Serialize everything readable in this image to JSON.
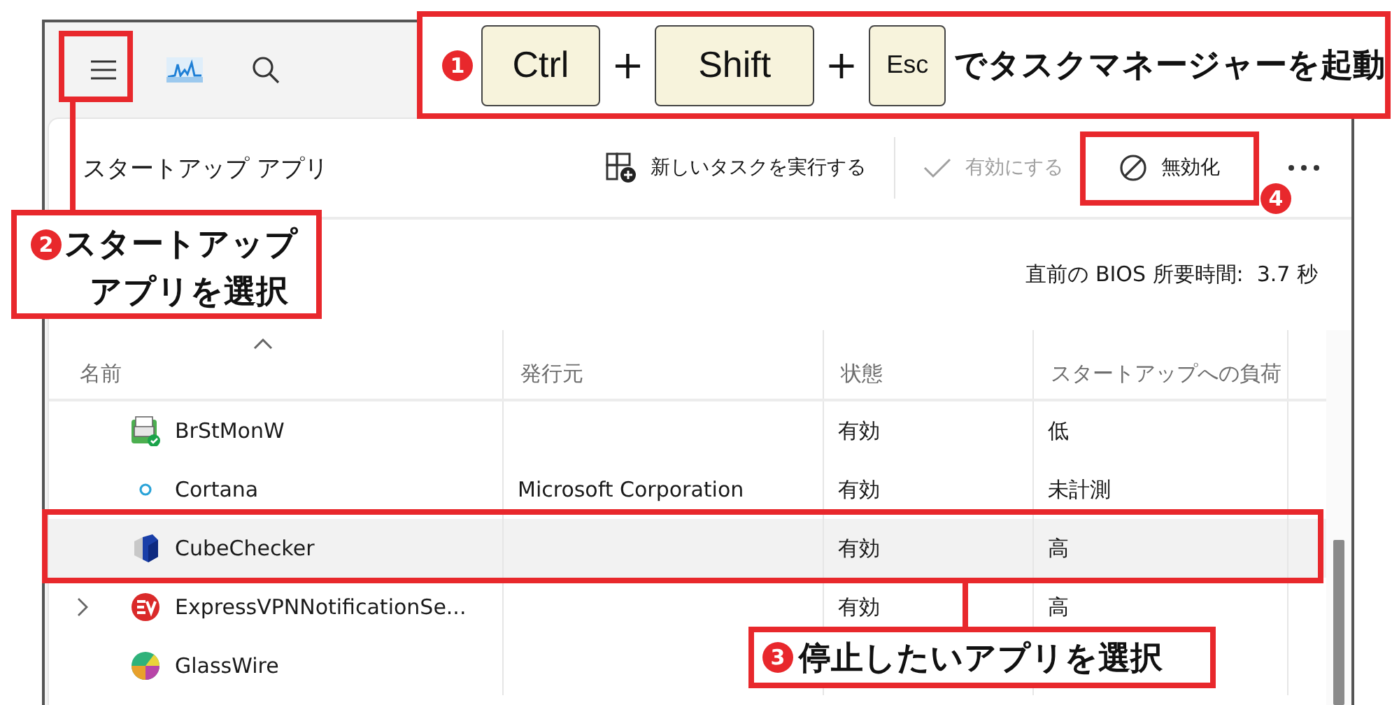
{
  "page_title": "スタートアップ アプリ",
  "commands": [
    {
      "kind": "new-task",
      "label": "新しいタスクを実行する",
      "disabled": false
    },
    {
      "kind": "enable",
      "label": "有効にする",
      "disabled": true
    },
    {
      "kind": "disable",
      "label": "無効化",
      "disabled": false
    }
  ],
  "bios_time": "直前の BIOS 所要時間:  3.7 秒",
  "table": {
    "columns": [
      {
        "label": "名前",
        "sorted": true
      },
      {
        "label": "発行元",
        "sorted": false
      },
      {
        "label": "状態",
        "sorted": false
      },
      {
        "label": "スタートアップへの負荷",
        "sorted": false
      }
    ],
    "rows": [
      {
        "name": "BrStMonW",
        "status": "有効",
        "impact": "低",
        "expandable": false,
        "selected": false
      },
      {
        "name": "Cortana",
        "publisher": "Microsoft Corporation",
        "status": "有効",
        "impact": "未計測",
        "expandable": false,
        "selected": false
      },
      {
        "name": "CubeChecker",
        "status": "有効",
        "impact": "高",
        "expandable": false,
        "selected": true
      },
      {
        "name": "ExpressVPNNotificationSe...",
        "status": "有効",
        "impact": "高",
        "expandable": true,
        "selected": false
      },
      {
        "name": "GlassWire",
        "expandable": false,
        "selected": false
      }
    ]
  },
  "annotations": {
    "step1": {
      "number": "1",
      "sequence": [
        {
          "kind": "key",
          "text": "Ctrl"
        },
        {
          "kind": "plus",
          "text": "+"
        },
        {
          "kind": "key",
          "text": "Shift"
        },
        {
          "kind": "plus",
          "text": "+"
        },
        {
          "kind": "key",
          "text": "Esc"
        },
        {
          "kind": "text",
          "text": "でタスクマネージャーを起動"
        }
      ]
    },
    "step2": {
      "number": "2",
      "lines": [
        "スタートアップ",
        "アプリを選択"
      ]
    },
    "step3": {
      "number": "3",
      "text": "停止したいアプリを選択"
    },
    "step4": {
      "number": "4"
    }
  }
}
